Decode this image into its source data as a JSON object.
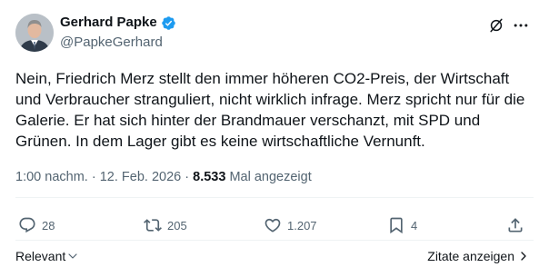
{
  "author": {
    "name": "Gerhard Papke",
    "handle": "@PapkeGerhard",
    "verified": true
  },
  "tweet": {
    "text": "Nein, Friedrich Merz stellt den immer höheren CO2-Preis, der Wirtschaft und Verbraucher stranguliert, nicht wirklich infrage. Merz spricht nur für die Galerie. Er hat sich hinter der Brandmauer verschanzt, mit SPD und Grünen. In dem Lager gibt es keine wirtschaftliche Vernunft."
  },
  "meta": {
    "time": "1:00 nachm.",
    "separator": "·",
    "date": "12. Feb. 2026",
    "views_count": "8.533",
    "views_label": "Mal angezeigt"
  },
  "actions": {
    "replies": "28",
    "reposts": "205",
    "likes": "1.207",
    "bookmarks": "4"
  },
  "footer": {
    "sort_label": "Relevant",
    "quotes_label": "Zitate anzeigen"
  },
  "colors": {
    "text": "#0f1419",
    "secondary": "#536471",
    "verified": "#1d9bf0",
    "divider": "#eff3f4"
  },
  "icons": [
    "verified-badge-icon",
    "grok-icon",
    "more-icon",
    "reply-icon",
    "repost-icon",
    "like-icon",
    "bookmark-icon",
    "share-icon",
    "chevron-down-icon",
    "chevron-right-icon"
  ]
}
